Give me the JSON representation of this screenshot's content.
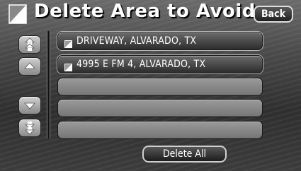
{
  "header": {
    "title": "Delete Area to Avoid",
    "back_label": "Back",
    "icon": "area-to-avoid-icon"
  },
  "list": {
    "items": [
      {
        "label": "DRIVEWAY, ALVARADO, TX",
        "icon": "area-item-icon"
      },
      {
        "label": "4995 E FM 4, ALVARADO, TX",
        "icon": "area-item-icon"
      },
      {
        "label": ""
      },
      {
        "label": ""
      },
      {
        "label": ""
      }
    ]
  },
  "scroll": {
    "buttons": [
      "page-up",
      "line-up",
      "line-down",
      "page-down"
    ]
  },
  "footer": {
    "delete_all_label": "Delete All"
  }
}
